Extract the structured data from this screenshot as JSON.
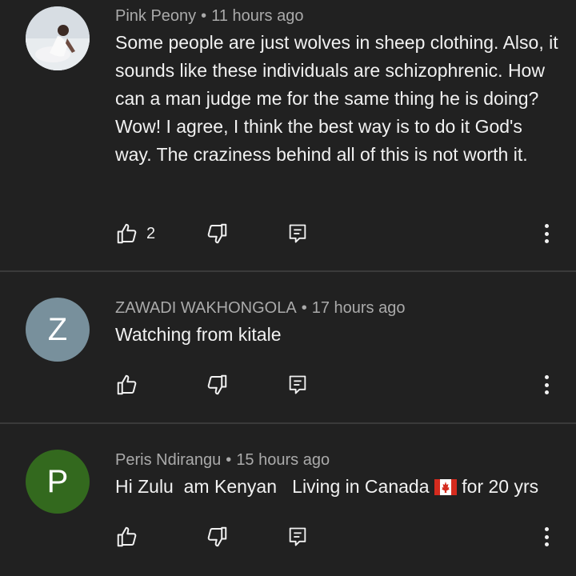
{
  "comments": [
    {
      "author": "Pink Peony",
      "time": "11 hours ago",
      "text": "Some people are just wolves in sheep clothing. Also, it sounds like these individuals are schizophrenic.   How can a man judge me for the same thing he is doing?  Wow!  I agree, I think the best way is to do it God's way.  The craziness behind all of this is not worth it.",
      "likes": "2",
      "avatar_type": "photo"
    },
    {
      "author": "ZAWADI WAKHONGOLA",
      "time": "17 hours ago",
      "text": "Watching from kitale",
      "likes": "",
      "avatar_letter": "Z",
      "avatar_color": "#78909c"
    },
    {
      "author": "Peris Ndirangu",
      "time": "15 hours ago",
      "text_before_flag": "Hi Zulu  am Kenyan   Living in Canada ",
      "text_after_flag": " for 20 yrs",
      "likes": "",
      "avatar_letter": "P",
      "avatar_color": "#33691e"
    }
  ],
  "separator": "•",
  "icons": [
    "like-icon",
    "dislike-icon",
    "reply-icon",
    "more-options-icon",
    "canada-flag-icon"
  ],
  "colors": {
    "background": "#212121",
    "meta": "#aaaaaa",
    "text": "#f1f1f1",
    "divider": "#3a3a3a"
  }
}
